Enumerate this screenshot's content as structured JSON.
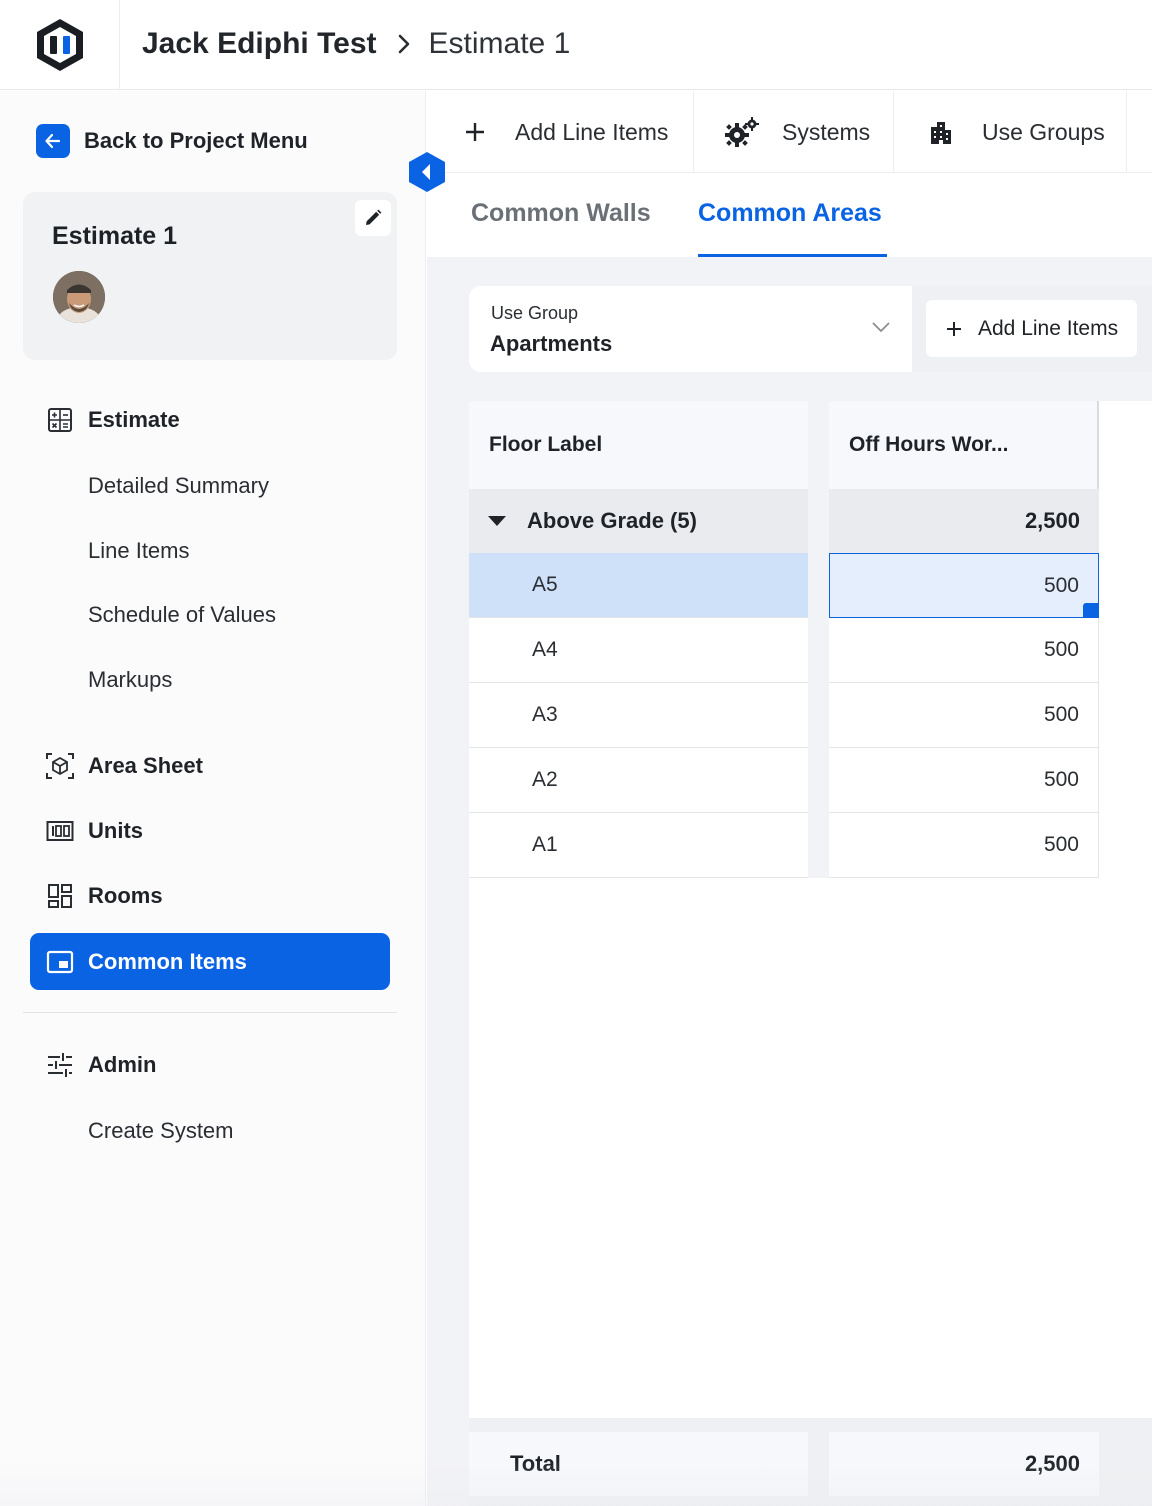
{
  "header": {
    "project_name": "Jack Ediphi Test",
    "current_estimate": "Estimate 1"
  },
  "sidebar": {
    "back_label": "Back to Project Menu",
    "estimate_card": {
      "title": "Estimate 1"
    },
    "nav": {
      "estimate": "Estimate",
      "estimate_subitems": [
        "Detailed Summary",
        "Line Items",
        "Schedule of Values",
        "Markups"
      ],
      "area_sheet": "Area Sheet",
      "units": "Units",
      "rooms": "Rooms",
      "common_items": "Common Items",
      "admin": "Admin",
      "admin_subitems": [
        "Create System"
      ]
    }
  },
  "toolbar": {
    "add_line_items": "Add Line Items",
    "systems": "Systems",
    "use_groups": "Use Groups"
  },
  "tabs": {
    "common_walls": "Common Walls",
    "common_areas": "Common Areas",
    "active": "Common Areas"
  },
  "filter": {
    "use_group_label": "Use Group",
    "use_group_value": "Apartments",
    "add_line_items": "Add Line Items"
  },
  "table": {
    "columns": [
      "Floor Label",
      "Off Hours Wor..."
    ],
    "group": {
      "label": "Above Grade (5)",
      "total": "2,500"
    },
    "rows": [
      {
        "floor": "A5",
        "value": "500",
        "selected": true
      },
      {
        "floor": "A4",
        "value": "500"
      },
      {
        "floor": "A3",
        "value": "500"
      },
      {
        "floor": "A2",
        "value": "500"
      },
      {
        "floor": "A1",
        "value": "500"
      }
    ],
    "total_label": "Total",
    "total_value": "2,500"
  },
  "colors": {
    "accent": "#0a63e3",
    "selected_row": "#cfe1f9",
    "selected_cell": "#e4eefc"
  }
}
